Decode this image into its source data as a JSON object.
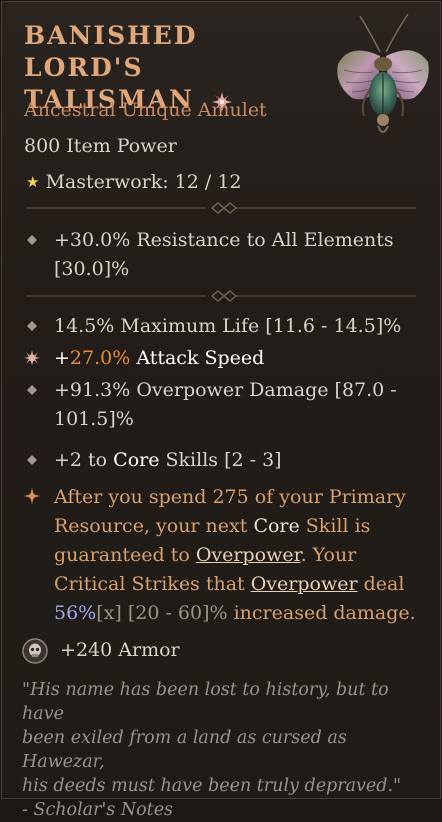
{
  "item": {
    "name_line1": "BANISHED LORD'S",
    "name_line2": "TALISMAN",
    "rarity": "Ancestral Unique Amulet",
    "item_power": "800 Item Power",
    "masterwork": "Masterwork: 12 / 12"
  },
  "implicits": [
    {
      "text_line1": "+30.0% Resistance to All Elements",
      "text_line2": "[30.0]%"
    }
  ],
  "affixes": [
    {
      "pre": "14.5% Maximum Life [11.6 - 14.5]%"
    },
    {
      "pre": "+",
      "highlight": "27.0%",
      "post": " Attack Speed"
    },
    {
      "line1": "+91.3% Overpower Damage [87.0 -",
      "line2": "101.5]%"
    },
    {
      "pre": "+2 to ",
      "core": "Core",
      "post": " Skills [2 - 3]"
    }
  ],
  "unique_power": {
    "l1": "After you spend 275 of your Primary",
    "l2a": "Resource, your next ",
    "l2b": "Core",
    "l2c": " Skill is",
    "l3a": "guaranteed to ",
    "l3b": "Overpower",
    "l3c": ". Your",
    "l4a": "Critical Strikes that ",
    "l4b": "Overpower",
    "l4c": " deal",
    "l5a": "56%",
    "l5b": "[x] [20 - 60]%",
    "l5c": " increased damage."
  },
  "armor": "+240 Armor",
  "flavor": {
    "l1": "\"His name has been lost to history, but to have",
    "l2": "been exiled from a land as cursed as Hawezar,",
    "l3": "his deeds must have been truly depraved.\"",
    "l4": "- Scholar's Notes"
  },
  "icons": {
    "unique": "unique-item-icon",
    "amulet": "beetle-amulet-icon",
    "masterwork": "star-icon",
    "bullet": "diamond-bullet-icon",
    "tempered": "burst-icon",
    "legendary": "legendary-power-icon",
    "armor": "skull-shield-icon"
  },
  "colors": {
    "title": "#e0a77a",
    "rarity": "#c9895f",
    "highlight": "#e88a3b",
    "legendary_text": "#d9a06f",
    "blue_value": "#9ea9f2"
  }
}
